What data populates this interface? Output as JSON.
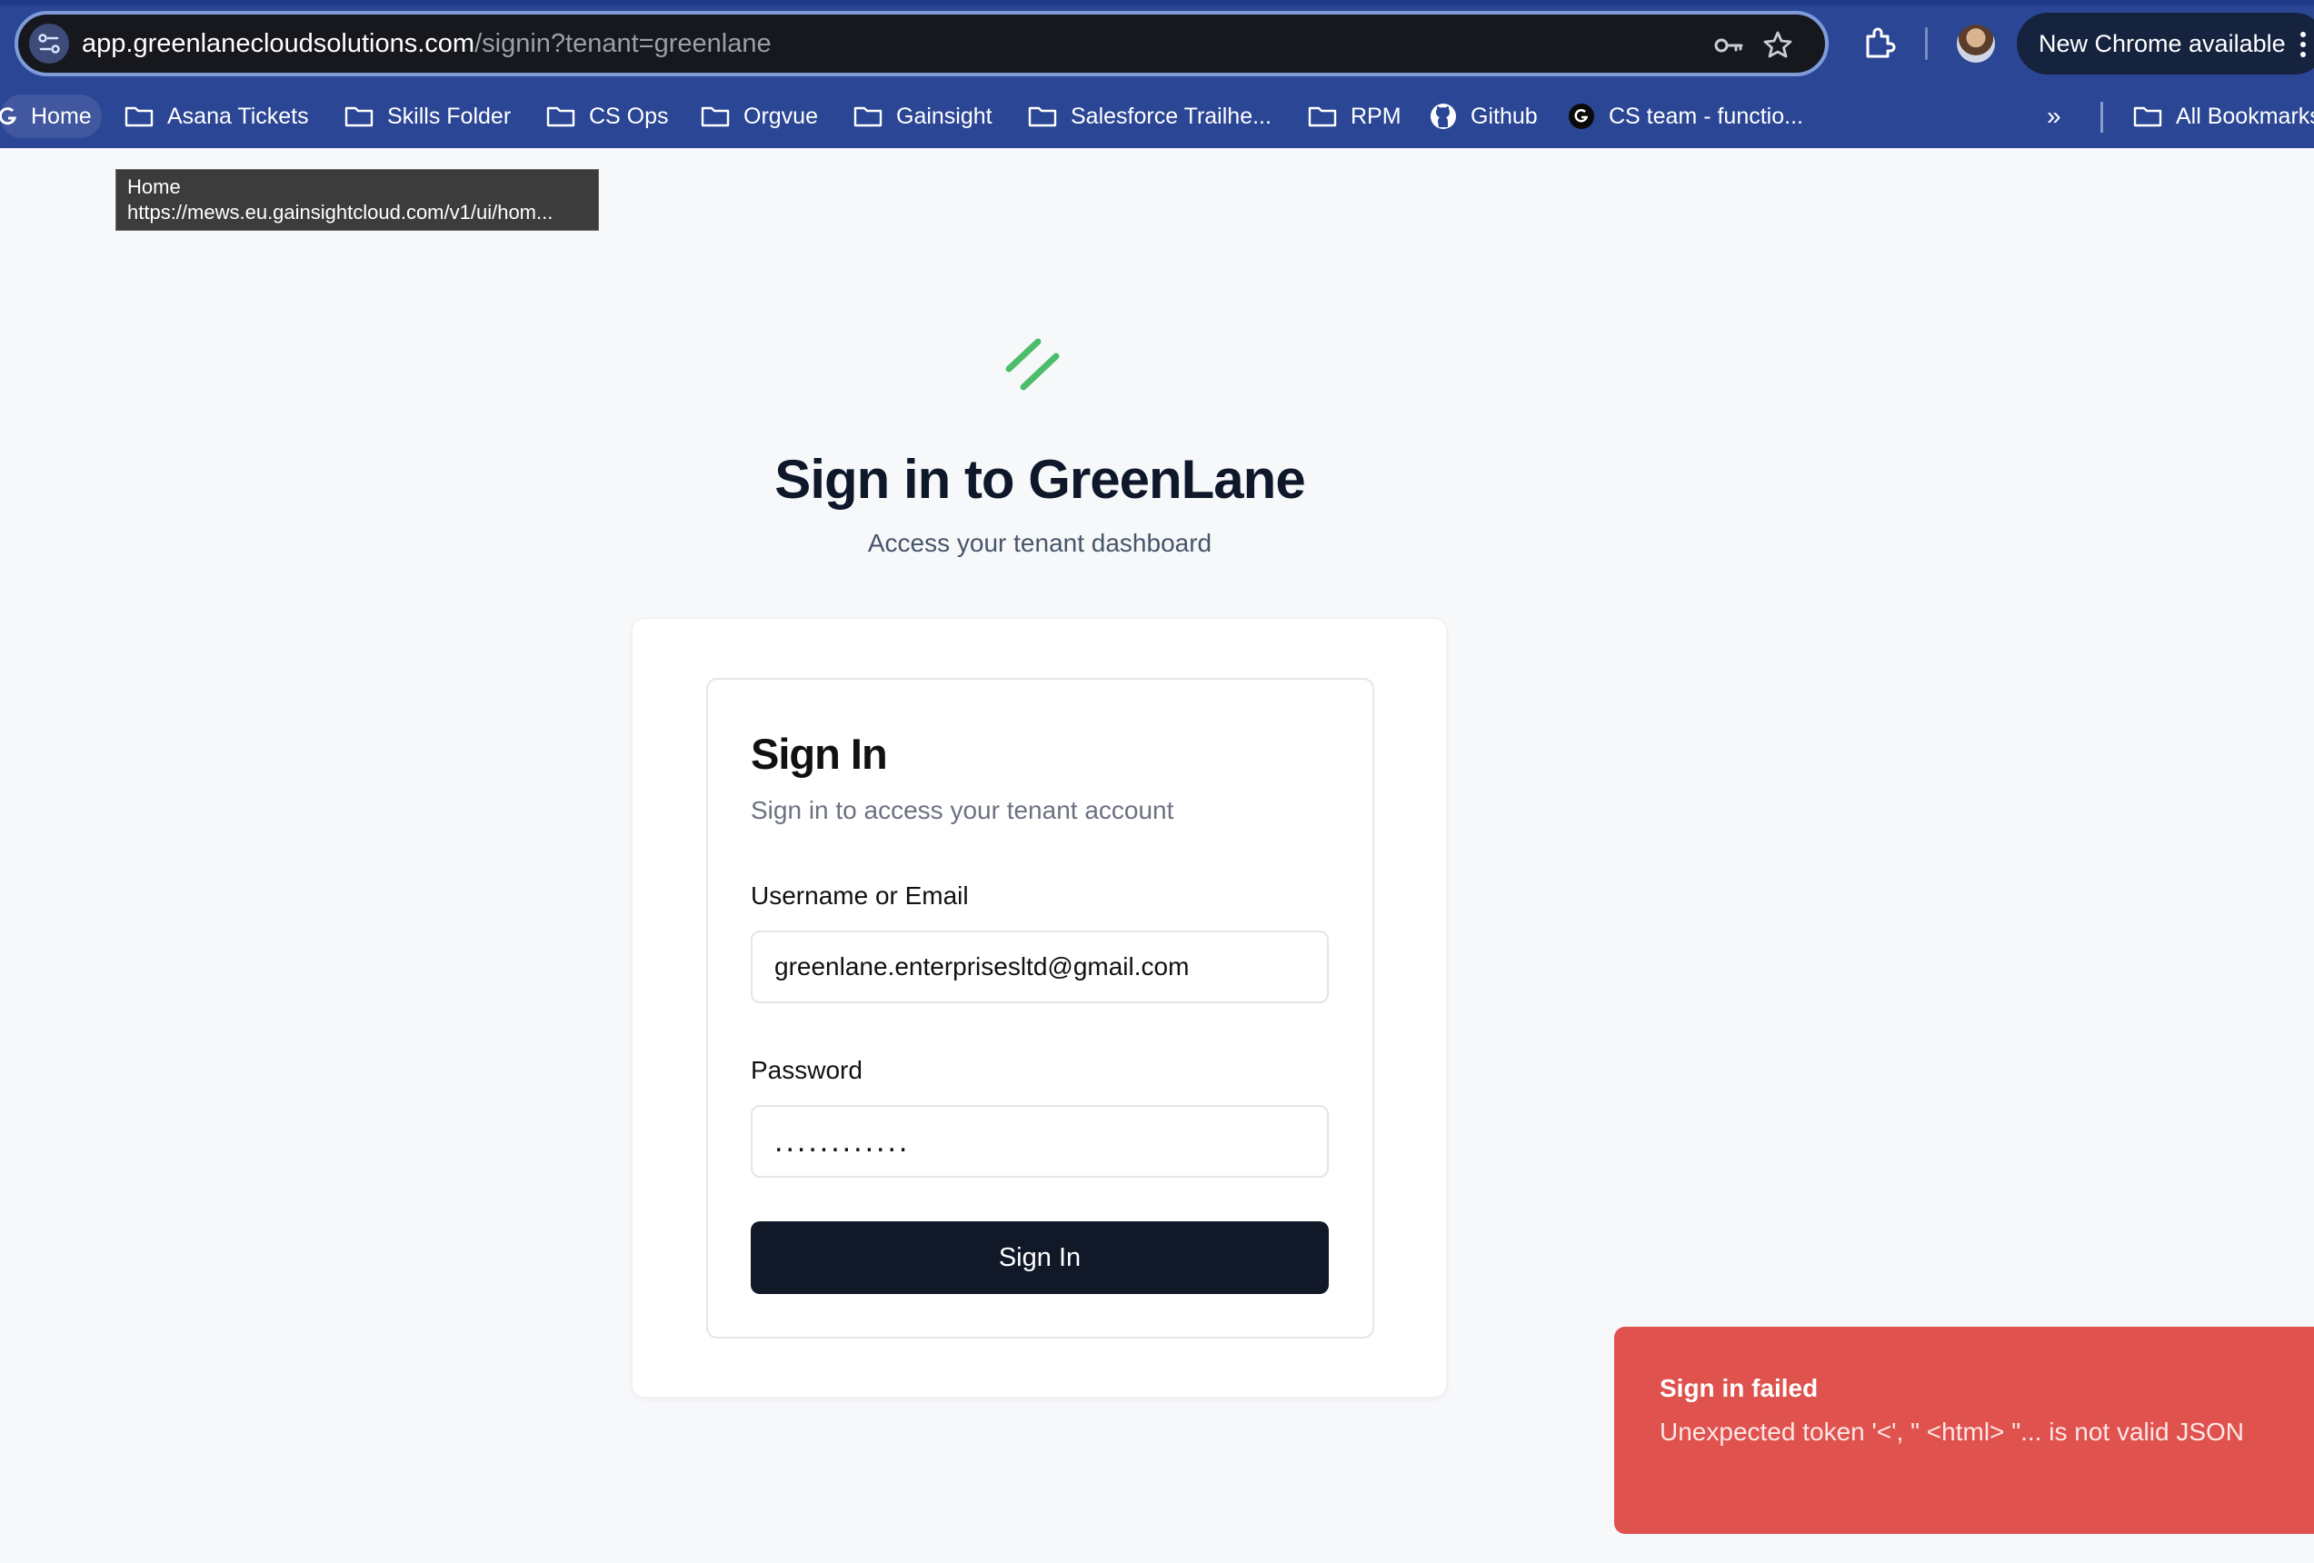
{
  "browser": {
    "url_host": "app.greenlanecloudsolutions.com",
    "url_path": "/signin?tenant=greenlane",
    "update_label": "New Chrome available",
    "bookmarks": [
      {
        "label": "Home",
        "icon": "gainsight-icon"
      },
      {
        "label": "Asana Tickets",
        "icon": "folder-icon"
      },
      {
        "label": "Skills Folder",
        "icon": "folder-icon"
      },
      {
        "label": "CS Ops",
        "icon": "folder-icon"
      },
      {
        "label": "Orgvue",
        "icon": "folder-icon"
      },
      {
        "label": "Gainsight",
        "icon": "folder-icon"
      },
      {
        "label": "Salesforce Trailhe...",
        "icon": "folder-icon"
      },
      {
        "label": "RPM",
        "icon": "folder-icon"
      },
      {
        "label": "Github",
        "icon": "github-icon"
      },
      {
        "label": "CS team - functio...",
        "icon": "gainsight-icon"
      }
    ],
    "all_bookmarks_label": "All Bookmarks",
    "more_bookmarks_glyph": "»"
  },
  "tooltip": {
    "title": "Home",
    "url": "https://mews.eu.gainsightcloud.com/v1/ui/hom..."
  },
  "page": {
    "heading": "Sign in to GreenLane",
    "subheading": "Access your tenant dashboard"
  },
  "form": {
    "title": "Sign In",
    "subtitle": "Sign in to access your tenant account",
    "username_label": "Username or Email",
    "username_value": "greenlane.enterprisesltd@gmail.com",
    "password_label": "Password",
    "password_value": "............",
    "submit_label": "Sign In"
  },
  "toast": {
    "title": "Sign in failed",
    "message": "Unexpected token '<', \" <html> \"... is not valid JSON"
  },
  "colors": {
    "chrome_bar": "#2b4695",
    "brand_green": "#4cbd6b",
    "button_dark": "#111827",
    "toast_red": "#df524e"
  }
}
